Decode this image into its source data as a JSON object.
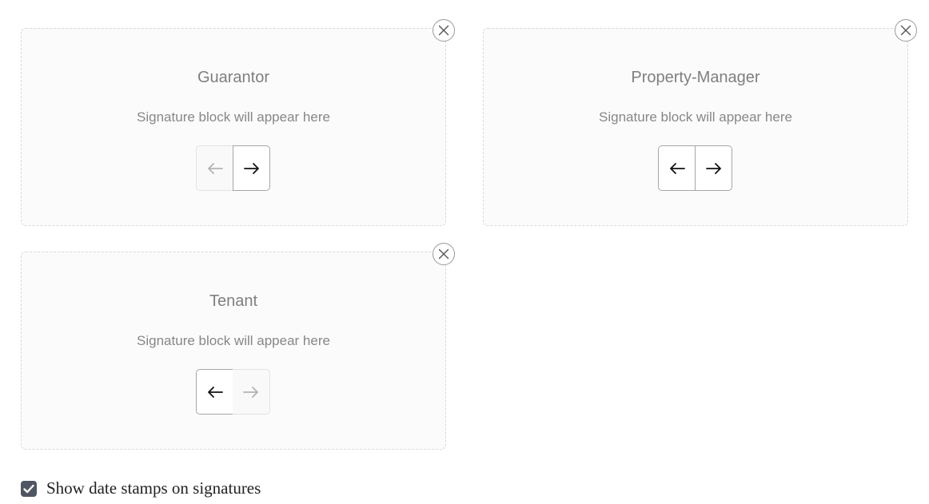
{
  "signature_blocks": [
    {
      "role": "Guarantor",
      "placeholder": "Signature block will appear here",
      "move_left_enabled": false,
      "move_right_enabled": true
    },
    {
      "role": "Property-Manager",
      "placeholder": "Signature block will appear here",
      "move_left_enabled": true,
      "move_right_enabled": true
    },
    {
      "role": "Tenant",
      "placeholder": "Signature block will appear here",
      "move_left_enabled": true,
      "move_right_enabled": false
    }
  ],
  "icons": {
    "remove": "close-icon",
    "move_left": "arrow-left-icon",
    "move_right": "arrow-right-icon",
    "checkbox": "checkmark-icon"
  },
  "date_stamps": {
    "label": "Show date stamps on signatures",
    "checked": true
  },
  "colors": {
    "block_border": "#d9d9d9",
    "block_background": "#fbfbfb",
    "title_text": "#7f7f7f",
    "checkbox_fill": "#4f5562",
    "arrow_enabled": "#111111",
    "arrow_disabled": "#b3b3b3"
  }
}
